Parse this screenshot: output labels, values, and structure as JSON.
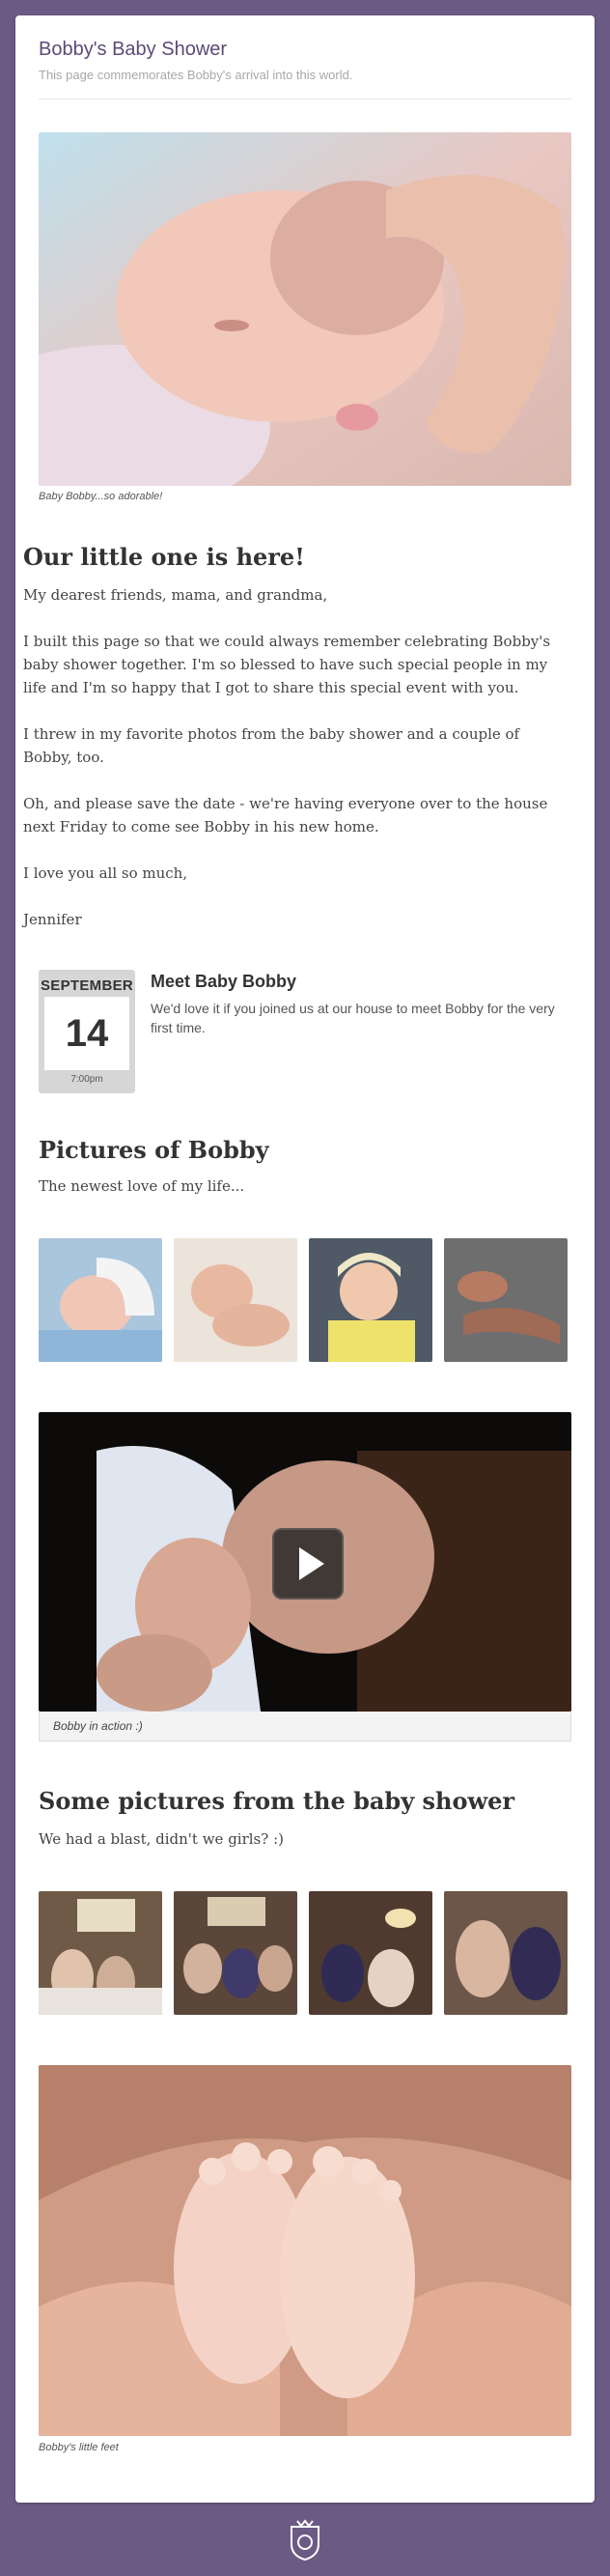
{
  "header": {
    "title": "Bobby's Baby Shower",
    "subtitle": "This page commemorates Bobby's arrival into this world."
  },
  "hero": {
    "caption": "Baby Bobby...so adorable!"
  },
  "intro": {
    "heading": "Our little one is here!",
    "paragraphs": [
      "My dearest friends, mama, and grandma,",
      "I built this page so that we could always remember celebrating Bobby's baby shower together. I'm so blessed to have such special people in my life and I'm so happy that I got to share this special event with you.",
      "I threw in my favorite photos from the baby shower and a couple of Bobby, too.",
      "Oh, and please save the date - we're having everyone over to the house next Friday to come see Bobby in his new home.",
      "I love you all so much,",
      "Jennifer"
    ]
  },
  "event": {
    "month": "SEPTEMBER",
    "day": "14",
    "time": "7:00pm",
    "title": "Meet Baby Bobby",
    "description": "We'd love it if you joined us at our house to meet Bobby for the very first time."
  },
  "pictures": {
    "heading": "Pictures of Bobby",
    "subtitle": "The newest love of my life..."
  },
  "video": {
    "caption": "Bobby in action :)"
  },
  "shower": {
    "heading": "Some pictures from the baby shower",
    "subtitle": "We had a blast, didn't we girls? :)"
  },
  "feet": {
    "caption": "Bobby's little feet"
  },
  "colors": {
    "background": "#6b5a84",
    "title": "#5b4a77",
    "card": "#ffffff"
  }
}
